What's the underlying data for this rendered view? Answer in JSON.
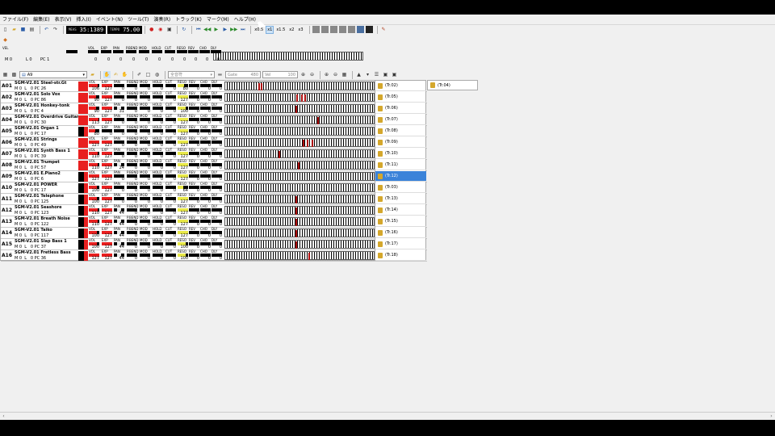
{
  "menu": [
    "ファイル(F)",
    "編集(E)",
    "表示(V)",
    "挿入(I)",
    "イベント(N)",
    "ツール(T)",
    "演奏(R)",
    "トラック(K)",
    "マーク(M)",
    "ヘルプ(H)"
  ],
  "transport": {
    "meas_label": "MEAS",
    "position": "35:1389",
    "tempo_label": "TEMPO",
    "tempo": "75.00",
    "speeds": [
      "x0.5",
      "x1",
      "x1.5",
      "x2",
      "x3"
    ],
    "active_speed": 1
  },
  "controller_labels": [
    "VEL",
    "VOL",
    "EXP",
    "PAN",
    "P.BEND",
    "MOD",
    "HOLD",
    "CUT",
    "RESO",
    "REV",
    "CHO",
    "DLY"
  ],
  "master": {
    "m": "M",
    "m_val": "0",
    "l": "L",
    "l_val": "0",
    "pc": "PC",
    "pc_val": "1",
    "vals": [
      "0",
      "0",
      "0",
      "0",
      "0",
      "0",
      "0",
      "0",
      "0",
      "0",
      "0",
      "0"
    ]
  },
  "toolbar2": {
    "port": "A9",
    "filter": "全音符",
    "gate_label": "Gate",
    "gate": "480",
    "vel_label": "Vel",
    "vel": "100"
  },
  "colors": {
    "volume": "#e82020",
    "pan_fill": "#e8e8e8",
    "rev_mark": "#e8e848",
    "note": "#b01010",
    "selected": "#3b83d9"
  },
  "tracks": [
    {
      "id": "A01",
      "name": "SGM-V2.01 Steel-str.Gt",
      "m": "0",
      "l": "0",
      "pc": "26",
      "v": [
        "106",
        "127",
        "0",
        "0",
        "0",
        "0",
        "0",
        "80",
        "0",
        "0",
        "0"
      ],
      "notes": [
        0.22,
        0.24
      ],
      "dark": false
    },
    {
      "id": "A02",
      "name": "SGM-V2.01 Solo Vox",
      "m": "0",
      "l": "0",
      "pc": "86",
      "v": [
        "90",
        "127",
        "0",
        "0",
        "0",
        "0",
        "0",
        "127",
        "0",
        "0",
        "0"
      ],
      "notes": [
        0.48,
        0.51,
        0.53
      ],
      "dark": false
    },
    {
      "id": "A03",
      "name": "SGM-V2.01 Honkey-tonk",
      "m": "0",
      "l": "0",
      "pc": "4",
      "v": [
        "90",
        "127",
        "31",
        "0",
        "0",
        "0",
        "0",
        "100",
        "0",
        "0",
        "0"
      ],
      "notes": [
        0.47
      ],
      "dark": false
    },
    {
      "id": "A04",
      "name": "SGM-V2.01 Overdrive Guitar",
      "m": "0",
      "l": "0",
      "pc": "30",
      "v": [
        "113",
        "127",
        "0",
        "0",
        "0",
        "0",
        "0",
        "127",
        "0",
        "0",
        "0"
      ],
      "notes": [
        0.62
      ],
      "dark": false
    },
    {
      "id": "A05",
      "name": "SGM-V2.01 Organ 1",
      "m": "0",
      "l": "0",
      "pc": "17",
      "v": [
        "80",
        "0",
        "0",
        "0",
        "0",
        "0",
        "0",
        "127",
        "0",
        "0",
        "0"
      ],
      "notes": [],
      "dark": true
    },
    {
      "id": "A06",
      "name": "SGM-V2.01 Strings",
      "m": "0",
      "l": "0",
      "pc": "49",
      "v": [
        "127",
        "127",
        "0",
        "0",
        "0",
        "0",
        "0",
        "127",
        "0",
        "0",
        "0"
      ],
      "notes": [
        0.52,
        0.55,
        0.58
      ],
      "dark": false
    },
    {
      "id": "A07",
      "name": "SGM-V2.01 Synth Bass 1",
      "m": "0",
      "l": "0",
      "pc": "39",
      "v": [
        "110",
        "127",
        "0",
        "0",
        "0",
        "0",
        "0",
        "127",
        "0",
        "0",
        "0"
      ],
      "notes": [
        0.36
      ],
      "dark": false
    },
    {
      "id": "A08",
      "name": "SGM-V2.01 Trumpet",
      "m": "0",
      "l": "0",
      "pc": "57",
      "v": [
        "110",
        "127",
        "24",
        "0",
        "0",
        "0",
        "0",
        "127",
        "0",
        "0",
        "0"
      ],
      "notes": [
        0.49
      ],
      "dark": false
    },
    {
      "id": "A09",
      "name": "SGM-V2.01 E.Piano2",
      "m": "0",
      "l": "0",
      "pc": "6",
      "v": [
        "127",
        "127",
        "0",
        "0",
        "0",
        "0",
        "0",
        "127",
        "0",
        "0",
        "0"
      ],
      "notes": [],
      "dark": true
    },
    {
      "id": "A10",
      "name": "SGM-V2.01 POWER",
      "m": "0",
      "l": "0",
      "pc": "17",
      "v": [
        "100",
        "127",
        "0",
        "0",
        "0",
        "0",
        "0",
        "64",
        "0",
        "0",
        "0"
      ],
      "notes": [],
      "dark": true
    },
    {
      "id": "A11",
      "name": "SGM-V2.01 Telephone",
      "m": "0",
      "l": "0",
      "pc": "125",
      "v": [
        "100",
        "127",
        "0",
        "0",
        "0",
        "0",
        "0",
        "127",
        "0",
        "0",
        "0"
      ],
      "notes": [
        0.47
      ],
      "dark": true
    },
    {
      "id": "A12",
      "name": "SGM-V2.01 Seashore",
      "m": "0",
      "l": "0",
      "pc": "123",
      "v": [
        "110",
        "127",
        "44",
        "0",
        "0",
        "0",
        "0",
        "127",
        "0",
        "0",
        "0"
      ],
      "notes": [
        0.47
      ],
      "dark": true
    },
    {
      "id": "A13",
      "name": "SGM-V2.01 Breath Noise",
      "m": "0",
      "l": "0",
      "pc": "122",
      "v": [
        "110",
        "127",
        "44",
        "0",
        "0",
        "0",
        "0",
        "127",
        "0",
        "0",
        "0"
      ],
      "notes": [
        0.47
      ],
      "dark": true
    },
    {
      "id": "A14",
      "name": "SGM-V2.01 Taiko",
      "m": "0",
      "l": "0",
      "pc": "117",
      "v": [
        "100",
        "127",
        "44",
        "0",
        "0",
        "0",
        "0",
        "127",
        "0",
        "0",
        "0"
      ],
      "notes": [
        0.47
      ],
      "dark": true
    },
    {
      "id": "A15",
      "name": "SGM-V2.01 Slap Bass 1",
      "m": "0",
      "l": "0",
      "pc": "37",
      "v": [
        "100",
        "127",
        "44",
        "0",
        "0",
        "0",
        "0",
        "100",
        "0",
        "0",
        "0"
      ],
      "notes": [
        0.47
      ],
      "dark": true
    },
    {
      "id": "A16",
      "name": "SGM-V2.01 Fretless Bass",
      "m": "0",
      "l": "0",
      "pc": "36",
      "v": [
        "127",
        "127",
        "44",
        "0",
        "0",
        "0",
        "0",
        "100",
        "0",
        "0",
        "0"
      ],
      "notes": [
        0.56
      ],
      "dark": true
    }
  ],
  "ports": [
    "(Tr.02)",
    "(Tr.05)",
    "(Tr.06)",
    "(Tr.07)",
    "(Tr.08)",
    "(Tr.09)",
    "(Tr.10)",
    "(Tr.11)",
    "(Tr.12)",
    "(Tr.03)",
    "(Tr.13)",
    "(Tr.14)",
    "(Tr.15)",
    "(Tr.16)",
    "(Tr.17)",
    "(Tr.18)"
  ],
  "selected_port": 8,
  "extra_port": "(Tr.04)"
}
